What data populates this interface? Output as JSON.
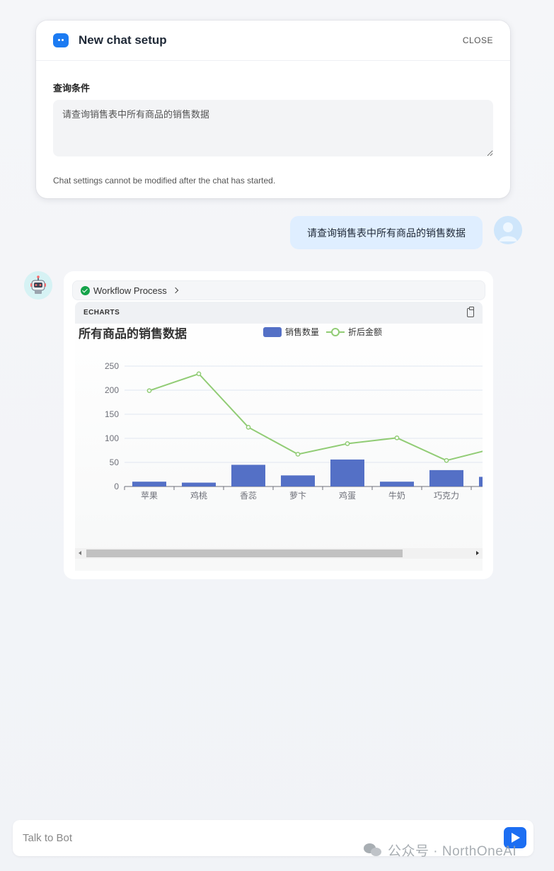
{
  "setup": {
    "title": "New chat setup",
    "close_label": "CLOSE",
    "field_label": "查询条件",
    "query_value": "请查询销售表中所有商品的销售数据",
    "note": "Chat settings cannot be modified after the chat has started."
  },
  "user_message": "请查询销售表中所有商品的销售数据",
  "bot": {
    "workflow_label": "Workflow Process",
    "block_label": "ECHARTS"
  },
  "chart_data": {
    "type": "bar",
    "title": "所有商品的销售数据",
    "categories": [
      "苹果",
      "鸡桃",
      "香蕊",
      "萝卞",
      "鸡蛋",
      "牛奶",
      "巧克力",
      ""
    ],
    "series": [
      {
        "name": "销售数量",
        "type": "bar",
        "color": "#5470c6",
        "values": [
          10,
          8,
          45,
          23,
          56,
          10,
          34,
          20
        ]
      },
      {
        "name": "折后金额",
        "type": "line",
        "color": "#91cc75",
        "values": [
          199,
          234,
          123,
          67,
          89,
          101,
          54,
          80
        ]
      }
    ],
    "ylim": [
      0,
      250
    ],
    "yticks": [
      0,
      50,
      100,
      150,
      200,
      250
    ],
    "grid": true,
    "legend_position": "top-center"
  },
  "input": {
    "placeholder": "Talk to Bot"
  },
  "watermark": "公众号 · NorthOneAI",
  "colors": {
    "accent": "#1c6ef2",
    "user_bubble": "#dfeeff",
    "bar": "#5470c6",
    "line": "#91cc75"
  }
}
